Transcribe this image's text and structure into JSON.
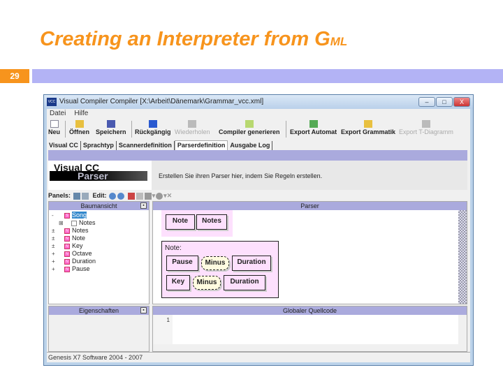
{
  "slide": {
    "title_main": "Creating an Interpreter from G",
    "title_sc": "ML",
    "number": "29"
  },
  "window": {
    "title": "Visual Compiler Compiler [X:\\Arbeit\\Dänemark\\Grammar_vcc.xml]",
    "app_icon": "VCC",
    "controls": [
      "–",
      "□",
      "X"
    ]
  },
  "menu": [
    "Datei",
    "Hilfe"
  ],
  "toolbar": [
    {
      "label": "Neu",
      "icon": "new-icon",
      "enabled": true
    },
    {
      "label": "Öffnen",
      "icon": "open-icon",
      "enabled": true
    },
    {
      "label": "Speichern",
      "icon": "save-icon",
      "enabled": true
    },
    {
      "label": "Rückgängig",
      "icon": "undo-icon",
      "enabled": true
    },
    {
      "label": "Wiederholen",
      "icon": "redo-icon",
      "enabled": false
    },
    {
      "label": "Compiler generieren",
      "icon": "generate-icon",
      "enabled": true
    },
    {
      "label": "Export Automat",
      "icon": "export-icon",
      "enabled": true
    },
    {
      "label": "Export Grammatik",
      "icon": "export-icon",
      "enabled": true
    },
    {
      "label": "Export T-Diagramm",
      "icon": "export-icon",
      "enabled": false
    }
  ],
  "tabs": [
    "Visual CC",
    "Sprachtyp",
    "Scannerdefinition",
    "Parserdefinition",
    "Ausgabe Log"
  ],
  "active_tab": "Parserdefinition",
  "header": {
    "logo_top": "Visual CC",
    "logo_bottom": "Parser",
    "description": "Erstellen Sie ihren Parser hier, indem Sie Regeln erstellen."
  },
  "panels_bar": {
    "panels_label": "Panels:",
    "edit_label": "Edit:"
  },
  "tree": {
    "title": "Baumansicht",
    "items": [
      {
        "label": "Song",
        "selected": true,
        "indent": 0
      },
      {
        "label": "Notes",
        "indent": 1
      },
      {
        "label": "Notes",
        "indent": 0
      },
      {
        "label": "Note",
        "indent": 0
      },
      {
        "label": "Key",
        "indent": 0
      },
      {
        "label": "Octave",
        "indent": 0
      },
      {
        "label": "Duration",
        "indent": 0
      },
      {
        "label": "Pause",
        "indent": 0
      }
    ]
  },
  "parser": {
    "title": "Parser",
    "rule1": [
      "Note",
      "Notes"
    ],
    "rule2_name": "Note:",
    "alt1": [
      "Pause",
      "Minus",
      "Duration"
    ],
    "alt2": [
      "Key",
      "Minus",
      "Duration"
    ]
  },
  "properties": {
    "title": "Eigenschaften"
  },
  "source": {
    "title": "Globaler Quellcode",
    "line": "1"
  },
  "status": "Genesis X7 Software 2004 - 2007",
  "colors": {
    "accent": "#f7941d",
    "bar": "#b3b3f5",
    "panel_header": "#aaaadd",
    "rule_bg": "#fde0fd"
  }
}
